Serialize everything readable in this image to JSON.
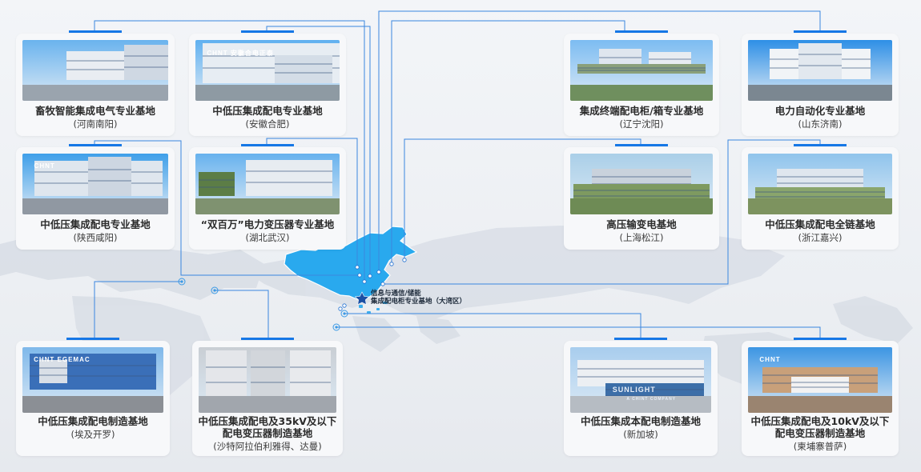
{
  "colors": {
    "accent": "#1677e6",
    "line": "#3a86df",
    "china": "#29a9ee",
    "world": "#d7dde5",
    "card": "#f7f8fa"
  },
  "map": {
    "hq_label_1": "信息与通信/储能",
    "hq_label_2": "集成配电柜专业基地（大湾区）"
  },
  "bases": [
    {
      "title": "畜牧智能集成电气专业基地",
      "location": "(河南南阳)"
    },
    {
      "title": "中低压集成配电专业基地",
      "location": "(安徽合肥)",
      "photo_text": "CHNT 安徽合电正泰"
    },
    {
      "title": "集成终端配电柜/箱专业基地",
      "location": "(辽宁沈阳)"
    },
    {
      "title": "电力自动化专业基地",
      "location": "(山东济南)"
    },
    {
      "title": "中低压集成配电专业基地",
      "location": "(陕西咸阳)",
      "photo_text": "CHNT"
    },
    {
      "title": "“双百万”电力变压器专业基地",
      "location": "(湖北武汉)"
    },
    {
      "title": "高压输变电基地",
      "location": "(上海松江)"
    },
    {
      "title": "中低压集成配电全链基地",
      "location": "(浙江嘉兴)"
    },
    {
      "title": "中低压集成配电制造基地",
      "location": "(埃及开罗)",
      "photo_text": "CHNT EGEMAC"
    },
    {
      "title": "中低压集成配电及35kV及以下",
      "title2": "配电变压器制造基地",
      "location": "(沙特阿拉伯利雅得、达曼)"
    },
    {
      "title": "中低压集成本配电制造基地",
      "location": "(新加坡)",
      "photo_text": "SUNLIGHT",
      "photo_text2": "A CHINT COMPANY"
    },
    {
      "title": "中低压集成配电及10kV及以下",
      "title2": "配电变压器制造基地",
      "location": "(柬埔寨普萨)",
      "photo_text": "CHNT"
    }
  ]
}
